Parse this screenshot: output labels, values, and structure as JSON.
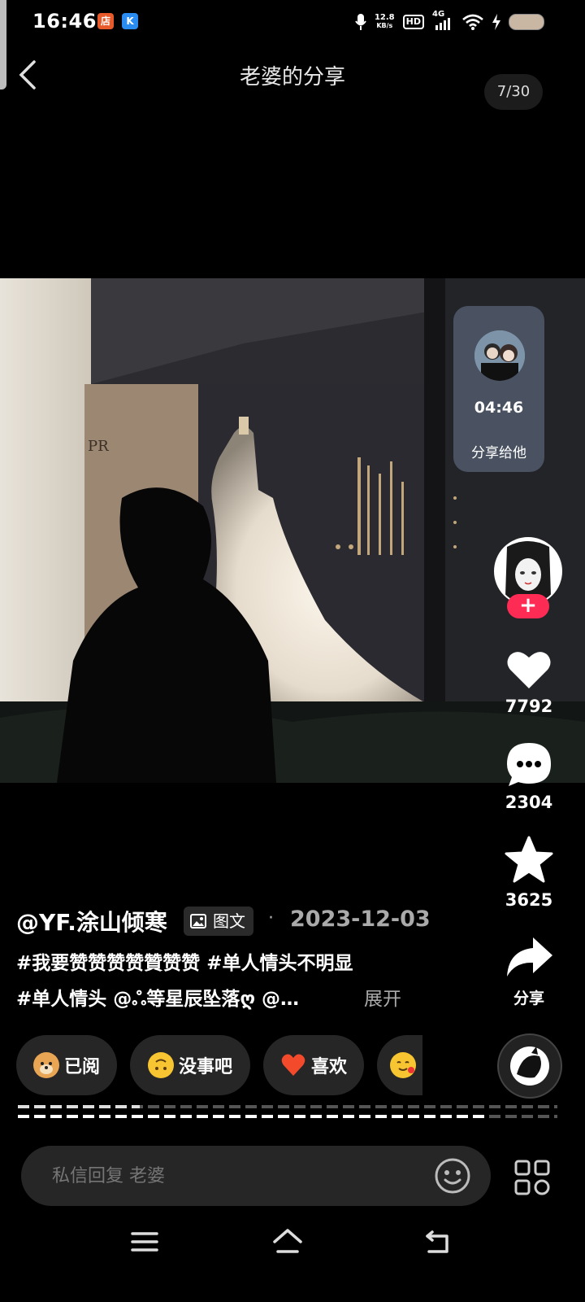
{
  "status_bar": {
    "time": "16:46",
    "app_badge_1": "店",
    "app_badge_2": "K",
    "net_speed_value": "12.8",
    "net_speed_unit": "KB/s",
    "hd": "HD",
    "network": "4G"
  },
  "header": {
    "title": "老婆的分享",
    "counter": "7/30"
  },
  "share_card": {
    "time": "04:46",
    "label": "分享给他"
  },
  "rail": {
    "follow": "+",
    "likes": "7792",
    "comments": "2304",
    "favorites": "3625",
    "share_label": "分享"
  },
  "caption": {
    "author": "@YF.涂山倾寒",
    "type_badge": "图文",
    "dot": "·",
    "date": "2023-12-03",
    "line1": "#我要赞赞赞赞贊赞赞 #单人情头不明显",
    "line2": "#单人情头 @ஃ等星辰坠落ღ @…",
    "expand": "展开"
  },
  "quick_replies": [
    {
      "label": "已阅",
      "icon": "doge-emoji"
    },
    {
      "label": "没事吧",
      "icon": "upside-down-face-emoji"
    },
    {
      "label": "喜欢",
      "icon": "heart-emoji"
    },
    {
      "label": "",
      "icon": "smiling-hearts-emoji"
    }
  ],
  "reply": {
    "placeholder": "私信回复 老婆"
  },
  "colors": {
    "accent": "#fe2c55",
    "chip_bg": "#262626"
  }
}
